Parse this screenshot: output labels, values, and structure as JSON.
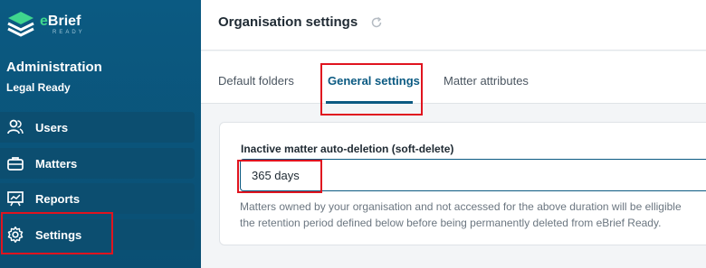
{
  "brand": {
    "name_prefix": "e",
    "name_rest": "Brief",
    "sub": "READY"
  },
  "sidebar": {
    "title": "Administration",
    "subtitle": "Legal Ready",
    "items": [
      {
        "label": "Users",
        "icon": "users-icon"
      },
      {
        "label": "Matters",
        "icon": "briefcase-icon"
      },
      {
        "label": "Reports",
        "icon": "reports-icon"
      },
      {
        "label": "Settings",
        "icon": "gear-icon"
      }
    ]
  },
  "header": {
    "title": "Organisation settings",
    "refresh_icon": "refresh-icon"
  },
  "tabs": [
    {
      "label": "Default folders"
    },
    {
      "label": "General settings",
      "active": true
    },
    {
      "label": "Matter attributes"
    }
  ],
  "form": {
    "field_label": "Inactive matter auto-deletion (soft-delete)",
    "field_value": "365 days",
    "help_line1": "Matters owned by your organisation and not accessed for the above duration will be elligible",
    "help_line2": "the retention period defined below before being permanently deleted from eBrief Ready."
  },
  "colors": {
    "sidebar": "#0b5a82",
    "accent": "#0b5a82",
    "highlight": "#e0141f",
    "brand_green": "#3fd68e"
  }
}
